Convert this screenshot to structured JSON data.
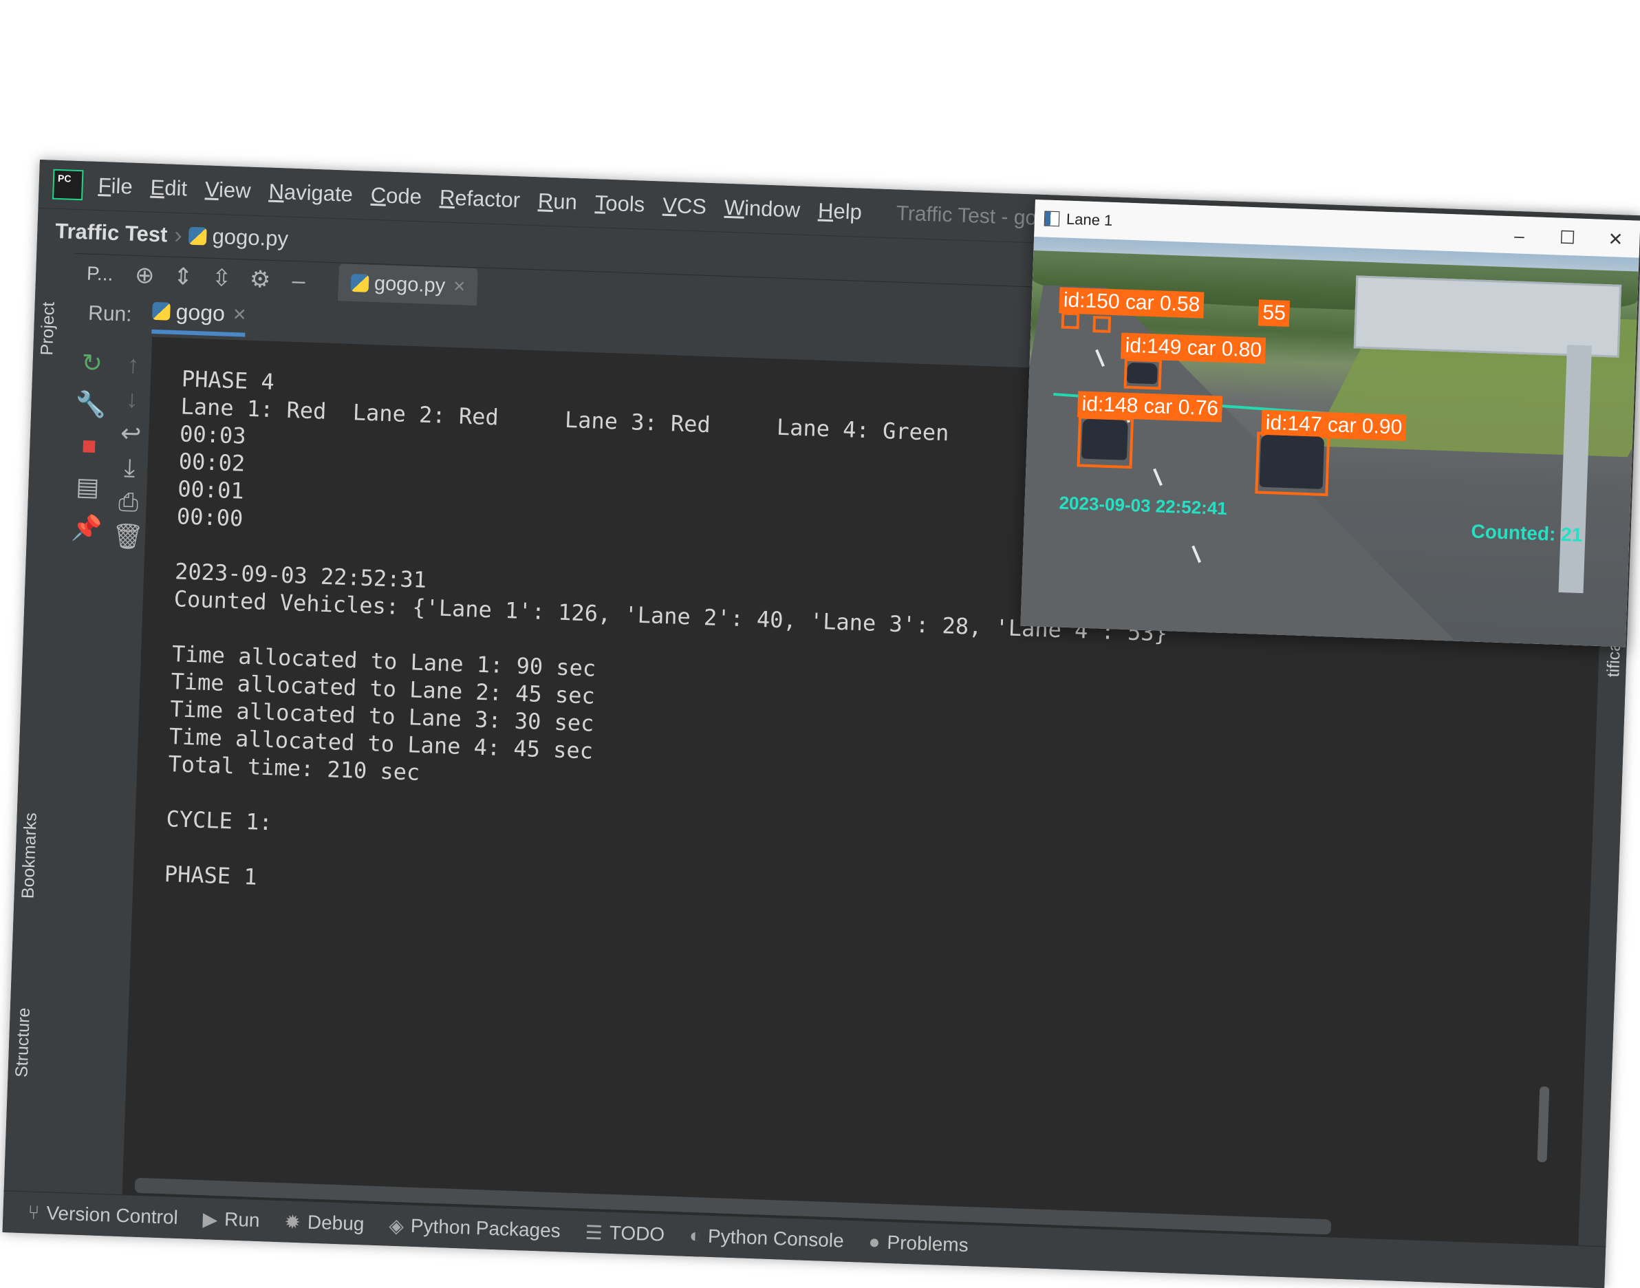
{
  "ide": {
    "menu": [
      "File",
      "Edit",
      "View",
      "Navigate",
      "Code",
      "Refactor",
      "Run",
      "Tools",
      "VCS",
      "Window",
      "Help"
    ],
    "window_title": "Traffic Test - gogo.py [Traffi",
    "breadcrumb": {
      "project": "Traffic Test",
      "file": "gogo.py"
    },
    "toolbar": {
      "project_short": "P...",
      "editor_tab": "gogo.py"
    },
    "left_tabs": {
      "project": "Project",
      "bookmarks": "Bookmarks",
      "structure": "Structure"
    },
    "right_tab": "tifications",
    "run": {
      "label": "Run:",
      "tab": "gogo",
      "console_lines": [
        "PHASE 4",
        "Lane 1: Red  Lane 2: Red     Lane 3: Red     Lane 4: Green",
        "00:03",
        "00:02",
        "00:01",
        "00:00",
        "",
        "2023-09-03 22:52:31",
        "Counted Vehicles: {'Lane 1': 126, 'Lane 2': 40, 'Lane 3': 28, 'Lane 4': 53}",
        "",
        "Time allocated to Lane 1: 90 sec",
        "Time allocated to Lane 2: 45 sec",
        "Time allocated to Lane 3: 30 sec",
        "Time allocated to Lane 4: 45 sec",
        "Total time: 210 sec",
        "",
        "CYCLE 1:",
        "",
        "PHASE 1"
      ]
    },
    "bottom_tools": [
      "Version Control",
      "Run",
      "Debug",
      "Python Packages",
      "TODO",
      "Python Console",
      "Problems"
    ]
  },
  "video": {
    "title": "Lane 1",
    "controls": {
      "minimize": "–",
      "maximize": "☐",
      "close": "✕"
    },
    "detections": [
      "id:150 car 0.58",
      "id:149 car 0.80",
      "id:148 car 0.76",
      "id:147 car 0.90"
    ],
    "extra_label": "55",
    "timestamp": "2023-09-03 22:52:41",
    "counted": "Counted: 21"
  },
  "colors": {
    "ide_bg": "#2b2b2b",
    "panel": "#3c3f41",
    "detection": "#ff6a13",
    "overlay_text": "#25e0c2",
    "rerun": "#59a869",
    "stop": "#e0443e"
  }
}
